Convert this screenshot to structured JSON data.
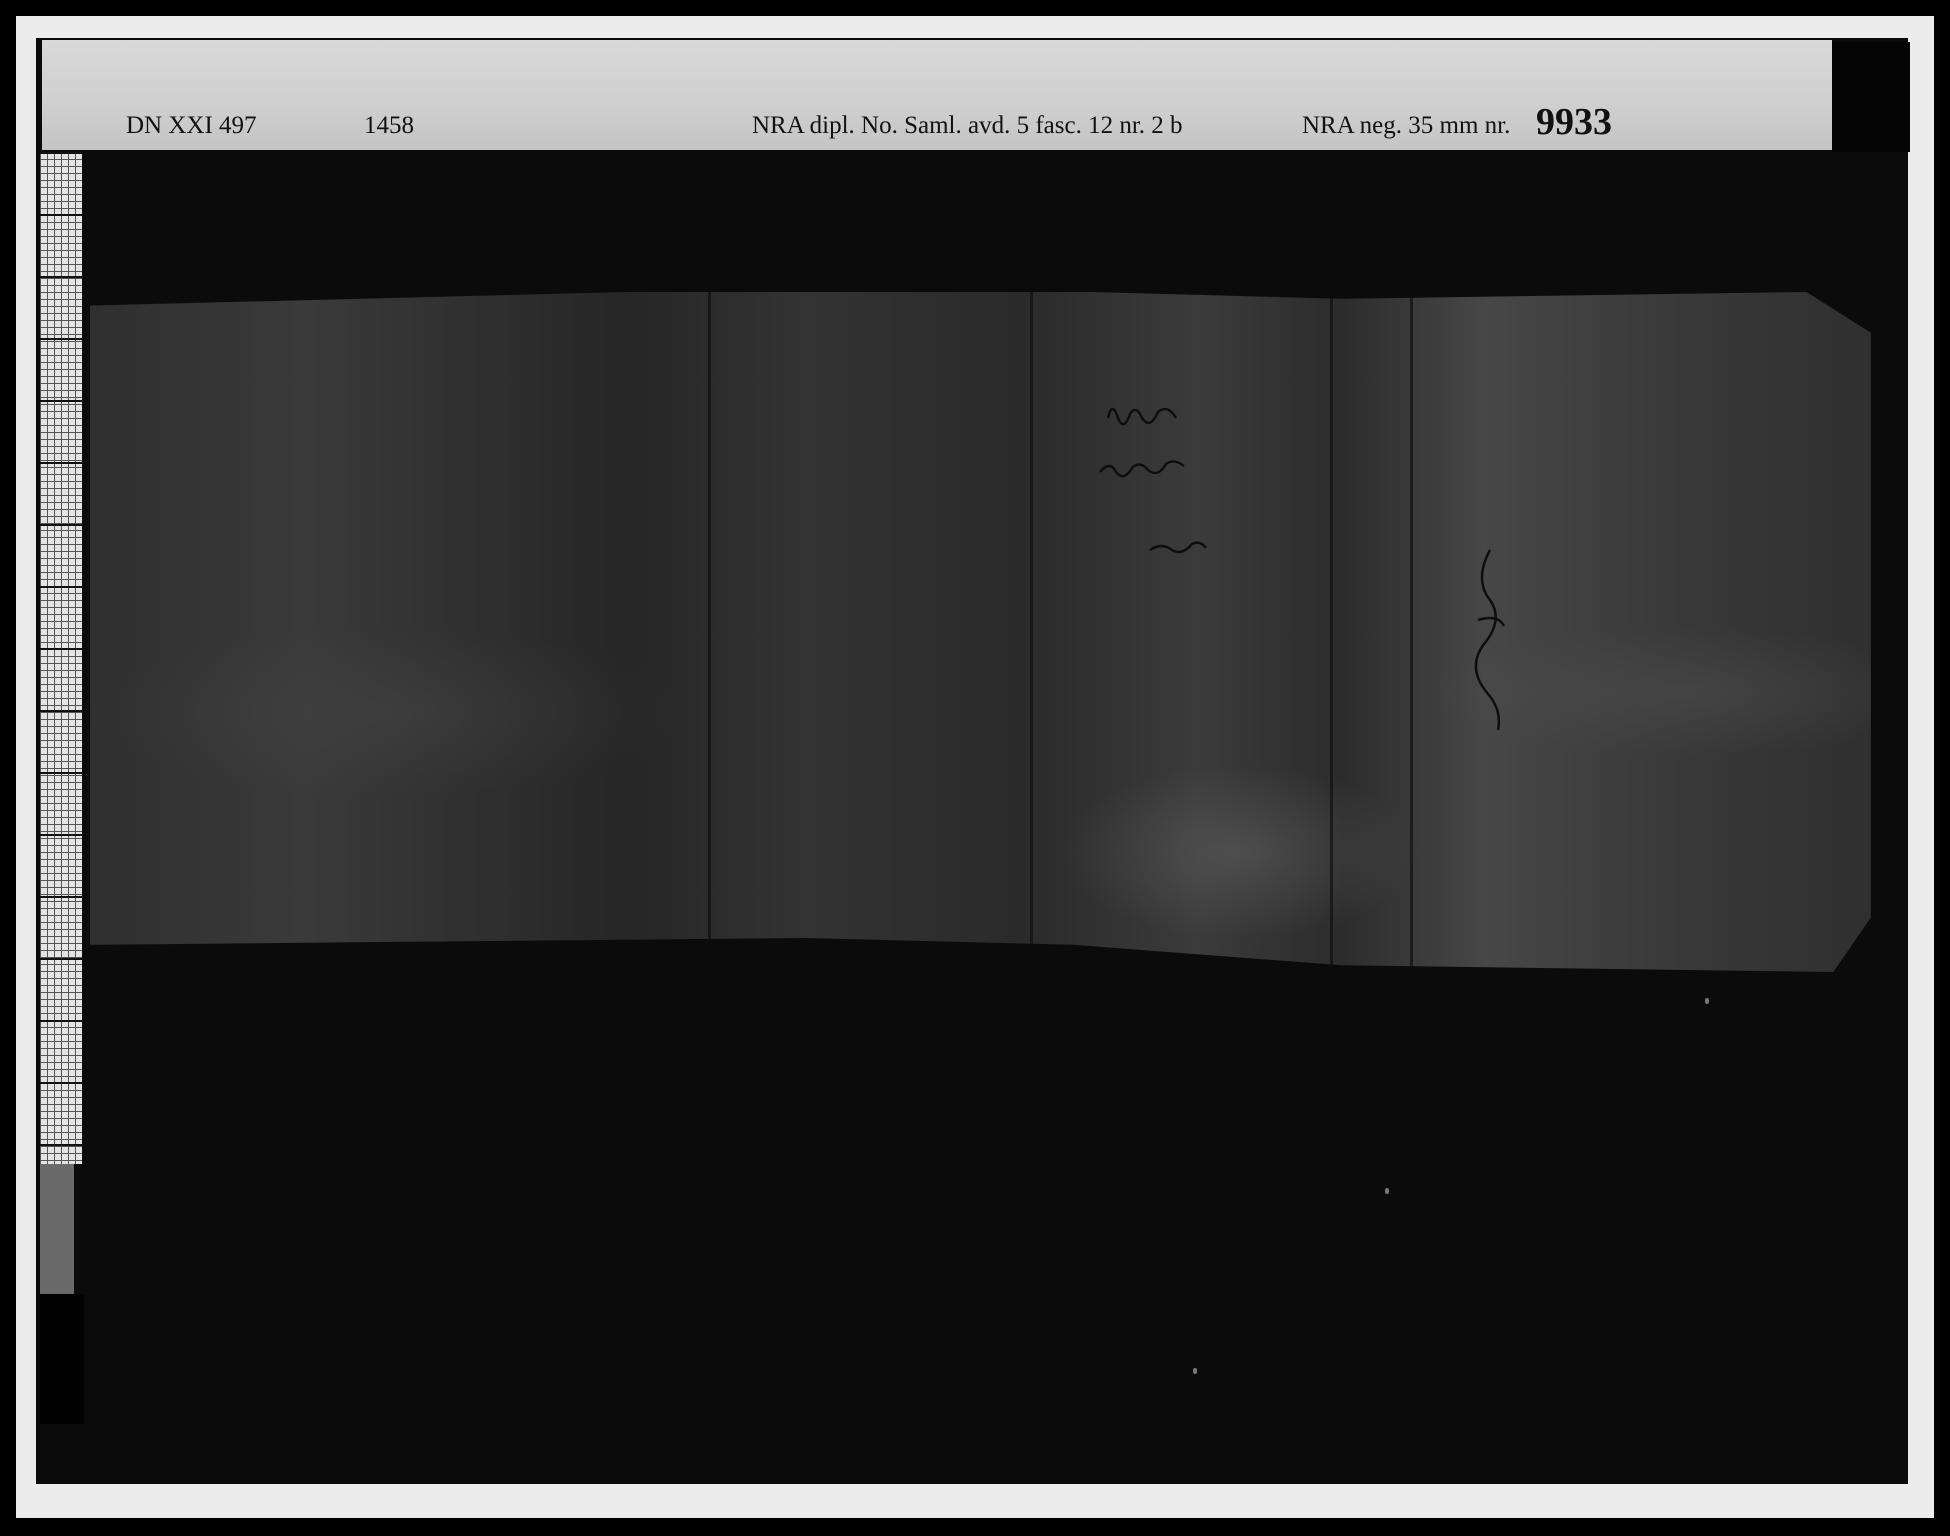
{
  "header": {
    "dn_ref": "DN XXI 497",
    "year": "1458",
    "nra_dipl": "NRA dipl.  No. Saml. avd. 5 fasc. 12 nr. 2 b",
    "nra_neg_label": "NRA neg. 35 mm nr.",
    "nra_neg_number": "9933"
  },
  "colors": {
    "label_strip": "#d3d3d3",
    "background": "#0b0b0b",
    "border": "#ececec"
  }
}
